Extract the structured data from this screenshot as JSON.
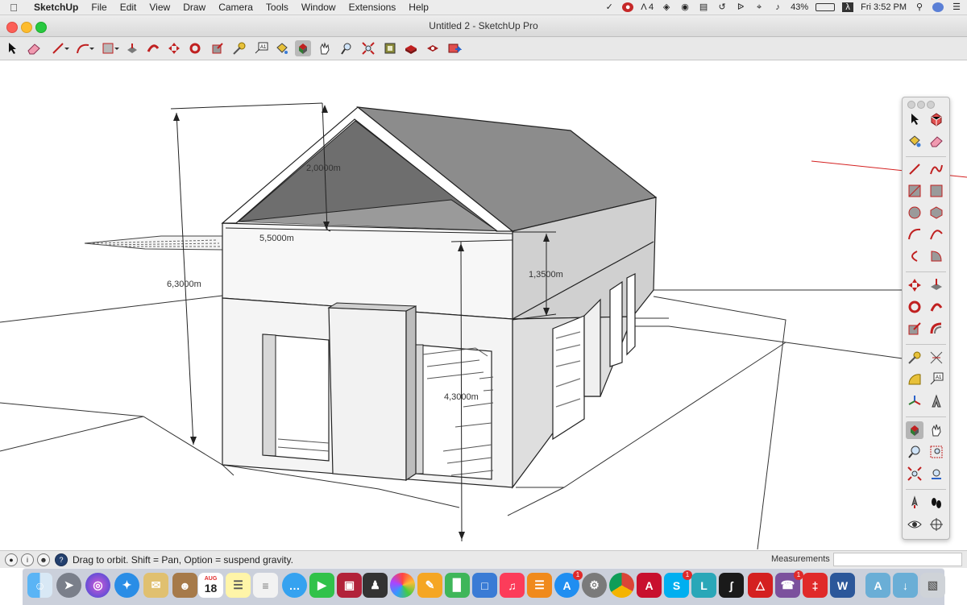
{
  "menubar": {
    "apple": "",
    "app_name": "SketchUp",
    "items": [
      "File",
      "Edit",
      "View",
      "Draw",
      "Camera",
      "Tools",
      "Window",
      "Extensions",
      "Help"
    ],
    "status": {
      "adobe_count": "4",
      "battery": "43%",
      "clock": "Fri 3:52 PM"
    }
  },
  "window": {
    "title": "Untitled 2 - SketchUp Pro"
  },
  "toolbar_icons": [
    "select-icon",
    "eraser-icon",
    "line-icon",
    "arc-icon",
    "rectangle-icon",
    "push-pull-icon",
    "follow-me-icon",
    "move-icon",
    "rotate-icon",
    "scale-icon",
    "tape-measure-icon",
    "text-icon",
    "paint-bucket-icon",
    "orbit-icon",
    "pan-icon",
    "zoom-icon",
    "zoom-extents-icon",
    "3d-warehouse-icon",
    "extension-warehouse-icon",
    "layout-icon",
    "send-icon"
  ],
  "dimensions": {
    "ridge_height": "2,0000m",
    "width": "5,5000m",
    "total_height": "6,3000m",
    "upper_band": "1,3500m",
    "wall_height": "4,3000m"
  },
  "statusbar": {
    "message": "Drag to orbit. Shift = Pan, Option = suspend gravity.",
    "measurements_label": "Measurements",
    "measurements_value": ""
  },
  "dock": {
    "calendar_month": "AUG",
    "calendar_day": "18",
    "app_store_badge": "1",
    "skype_badge": "1",
    "viber_badge": "1"
  },
  "colors": {
    "axis_red": "#d42020",
    "roof": "#8c8c8c",
    "gable": "#6e6e6e",
    "side_wall": "#dcdcdc",
    "front_wall": "#f4f4f4"
  }
}
